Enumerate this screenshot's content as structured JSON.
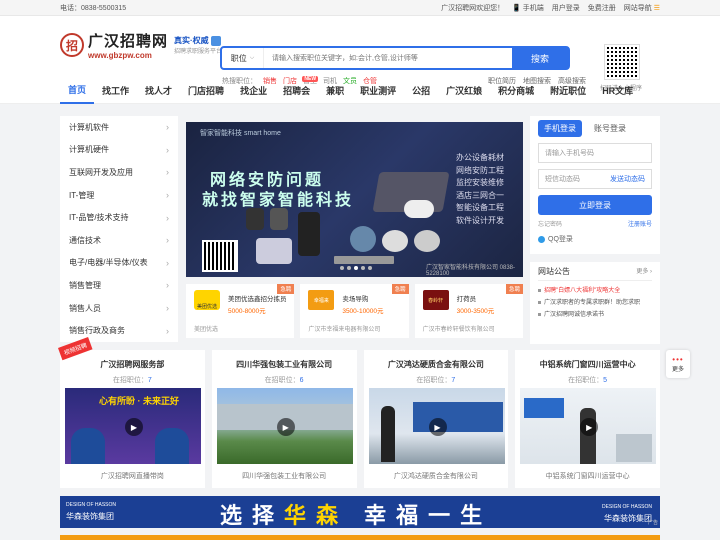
{
  "topbar": {
    "phone": "电话：0838-5500315",
    "welcome": "广汉招聘网欢迎您！",
    "mobile": "手机端",
    "user_login": "用户登录",
    "free_register": "免费注册",
    "site_nav": "网站导航"
  },
  "logo": {
    "name": "广汉招聘网",
    "url": "www.gbzpw.com",
    "slogan1": "真实·权威",
    "slogan2": "招聘求职服务平台"
  },
  "search": {
    "select": "职位",
    "placeholder": "请输入搜索职位关键字，如:会计,仓管,设计师等",
    "button": "搜索",
    "hot_label": "热搜职位：",
    "hot": [
      "销售",
      "门店",
      "普工",
      "司机",
      "文员",
      "仓管"
    ],
    "links": [
      "职位简历",
      "地图搜索",
      "高级搜索"
    ]
  },
  "qr_label": "扫码进入小程序",
  "nav": {
    "items": [
      "首页",
      "找工作",
      "找人才",
      "门店招聘",
      "找企业",
      "招聘会",
      "兼职",
      "职业测评",
      "公招",
      "广汉红娘",
      "积分商城",
      "附近职位",
      "HR文库"
    ],
    "badge": "NEW"
  },
  "categories": [
    "计算机软件",
    "计算机硬件",
    "互联网开发及应用",
    "IT-管理",
    "IT-品管/技术支持",
    "通信技术",
    "电子/电器/半导体/仪表",
    "销售管理",
    "销售人员",
    "销售行政及商务"
  ],
  "banner": {
    "brand": "智家智能科技 smart home",
    "headline1": "网络安防问题",
    "headline2": "就找智家智能科技",
    "list": [
      "办公设备耗材",
      "网络安防工程",
      "监控安装维修",
      "酒店三网合一",
      "智能设备工程",
      "软件设计开发"
    ],
    "phone": "广汉智家智能科技有限公司 0838-5228100"
  },
  "login": {
    "tab_phone": "手机登录",
    "tab_account": "账号登录",
    "phone_placeholder": "请输入手机号码",
    "sms_placeholder": "短信动态码",
    "send_code": "发送动态码",
    "login_button": "立即登录",
    "forgot": "忘记密码",
    "register": "注册账号",
    "qq": "QQ登录"
  },
  "notice": {
    "title": "网站公告",
    "more": "更多",
    "items": [
      "招聘\"白嫖八大福利\"攻略大全",
      "广汉求职者的专属求职群！助您求职",
      "广汉招聘网诚信承诺书"
    ]
  },
  "jobs": [
    {
      "tag": "急聘",
      "logo": "美团优选",
      "title": "美团优选鑫招分拣员",
      "salary": "5000-8000元",
      "company": "美团优选"
    },
    {
      "tag": "急聘",
      "logo": "幸福来",
      "title": "卖场导购",
      "salary": "3500-10000元",
      "company": "广汉市幸福来电器有限公司"
    },
    {
      "tag": "急聘",
      "logo": "春岭轩",
      "title": "打荷员",
      "salary": "3000-3500元",
      "company": "广汉市春岭轩餐饮有限公司"
    }
  ],
  "tools": {
    "label": "更多"
  },
  "cards": [
    {
      "ribbon": "视频招聘",
      "name": "广汉招聘网服务部",
      "count_label": "在招职位：",
      "count": "7",
      "footer": "广汉招聘网直播带岗"
    },
    {
      "name": "四川华强包装工业有限公司",
      "count_label": "在招职位：",
      "count": "6",
      "footer": "四川华强包装工业有限公司"
    },
    {
      "name": "广汉鸿达硬质合金有限公司",
      "count_label": "在招职位：",
      "count": "7",
      "footer": "广汉鸿达硬质合金有限公司"
    },
    {
      "name": "中铝系统门窗四川运营中心",
      "count_label": "在招职位：",
      "count": "5",
      "footer": "中铝系统门窗四川运营中心"
    }
  ],
  "ad": {
    "left1": "DESIGN OF HASSON",
    "left2": "华森装饰集团",
    "slogan_a": "选择",
    "slogan_b": "华森",
    "slogan_c": "幸福一生",
    "right1": "DESIGN OF HASSON",
    "right2": "华森装饰集团",
    "ad_tag": "广告"
  },
  "colors": {
    "primary": "#2f6fe8",
    "accent": "#e33333",
    "salary": "#ff6600"
  }
}
